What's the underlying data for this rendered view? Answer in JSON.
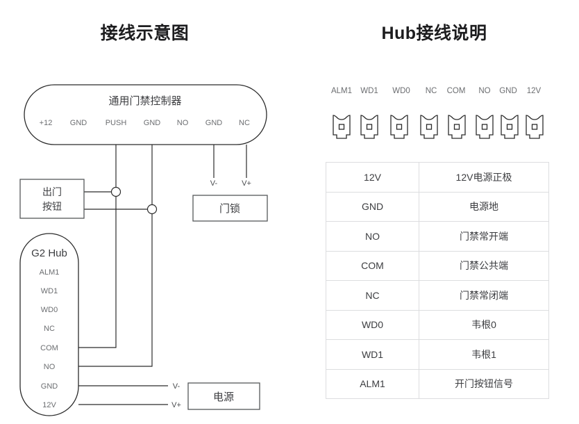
{
  "panels": {
    "left": {
      "title": "接线示意图"
    },
    "right": {
      "title": "Hub接线说明"
    }
  },
  "controller": {
    "name": "通用门禁控制器",
    "pins": [
      "+12",
      "GND",
      "PUSH",
      "GND",
      "NO",
      "GND",
      "NC"
    ]
  },
  "hub": {
    "name": "G2 Hub",
    "pins": [
      "ALM1",
      "WD1",
      "WD0",
      "NC",
      "COM",
      "NO",
      "GND",
      "12V"
    ]
  },
  "devices": {
    "exit_button": {
      "line1": "出门",
      "line2": "按钮"
    },
    "door_lock": {
      "name": "门锁",
      "neg": "V-",
      "pos": "V+"
    },
    "power_supply": {
      "name": "电源",
      "neg": "V-",
      "pos": "V+"
    }
  },
  "lock_wire_labels": {
    "neg": "V-",
    "pos": "V+"
  },
  "terminals": {
    "labels": [
      "ALM1",
      "WD1",
      "WD0",
      "NC",
      "COM",
      "NO",
      "GND",
      "12V"
    ],
    "icon": "terminal-connector-icon"
  },
  "table": {
    "rows": [
      {
        "signal": "12V",
        "desc": "12V电源正极"
      },
      {
        "signal": "GND",
        "desc": "电源地"
      },
      {
        "signal": "NO",
        "desc": "门禁常开端"
      },
      {
        "signal": "COM",
        "desc": "门禁公共端"
      },
      {
        "signal": "NC",
        "desc": "门禁常闭端"
      },
      {
        "signal": "WD0",
        "desc": "韦根0"
      },
      {
        "signal": "WD1",
        "desc": "韦根1"
      },
      {
        "signal": "ALM1",
        "desc": "开门按钮信号"
      }
    ]
  },
  "colors": {
    "background": "#ffffff",
    "title": "#1d1d1f",
    "wire": "#2b2b2b",
    "label": "#6b6d70",
    "table_border": "#dcdddf",
    "table_text": "#3c3d40"
  }
}
